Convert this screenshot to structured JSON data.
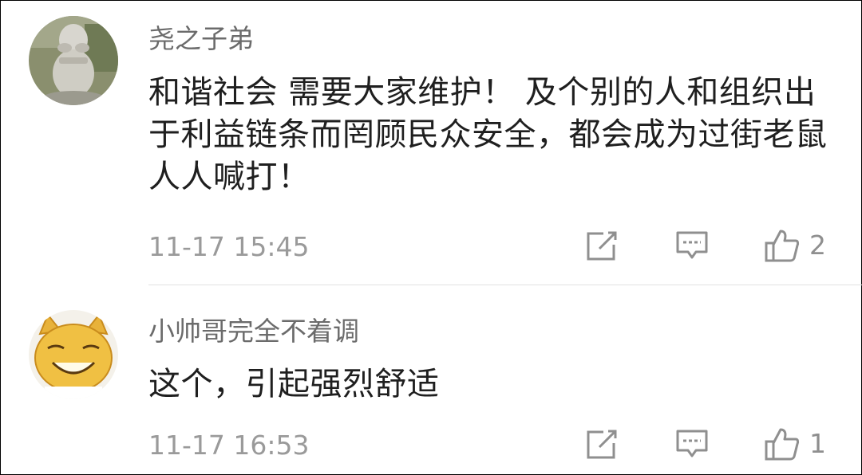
{
  "comments": [
    {
      "username": "尧之子弟",
      "text": "和谐社会 需要大家维护！ 及个别的人和组织出于利益链条而罔顾民众安全，都会成为过街老鼠人人喊打！",
      "time": "11-17 15:45",
      "likes": "2",
      "avatar_icon": "stone-monk-statue-avatar"
    },
    {
      "username": "小帅哥完全不着调",
      "text": "这个，引起强烈舒适",
      "time": "11-17 16:53",
      "likes": "1",
      "avatar_icon": "yellow-cat-face-avatar"
    }
  ],
  "icons": {
    "share": "share-icon",
    "reply": "reply-icon",
    "like": "thumbs-up-icon"
  },
  "colors": {
    "username": "#6b6b6b",
    "text": "#1f1f1f",
    "meta": "#9a9a9a",
    "divider": "#e2e2e2"
  }
}
